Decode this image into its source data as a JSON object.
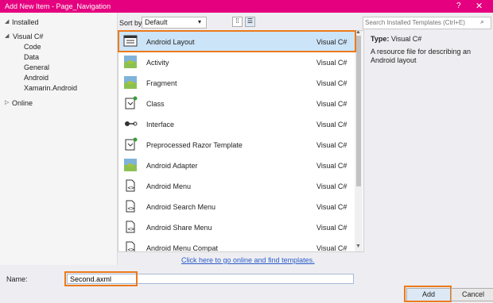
{
  "window": {
    "title": "Add New Item - Page_Navigation",
    "help_glyph": "?",
    "close_glyph": "✕"
  },
  "tree": {
    "installed": "Installed",
    "visual_csharp": "Visual C#",
    "children": [
      "Code",
      "Data",
      "General",
      "Android",
      "Xamarin.Android"
    ],
    "online": "Online"
  },
  "toolbar": {
    "sort_label": "Sort by:",
    "sort_value": "Default"
  },
  "templates": [
    {
      "name": "Android Layout",
      "lang": "Visual C#",
      "icon": "layout-icon"
    },
    {
      "name": "Activity",
      "lang": "Visual C#",
      "icon": "android-icon"
    },
    {
      "name": "Fragment",
      "lang": "Visual C#",
      "icon": "android-icon"
    },
    {
      "name": "Class",
      "lang": "Visual C#",
      "icon": "class-icon"
    },
    {
      "name": "Interface",
      "lang": "Visual C#",
      "icon": "interface-icon"
    },
    {
      "name": "Preprocessed Razor Template",
      "lang": "Visual C#",
      "icon": "razor-icon"
    },
    {
      "name": "Android Adapter",
      "lang": "Visual C#",
      "icon": "android-icon"
    },
    {
      "name": "Android Menu",
      "lang": "Visual C#",
      "icon": "menu-icon"
    },
    {
      "name": "Android Search Menu",
      "lang": "Visual C#",
      "icon": "menu-icon"
    },
    {
      "name": "Android Share Menu",
      "lang": "Visual C#",
      "icon": "menu-icon"
    },
    {
      "name": "Android Menu Compat",
      "lang": "Visual C#",
      "icon": "menu-icon"
    }
  ],
  "details": {
    "search_placeholder": "Search Installed Templates (Ctrl+E)",
    "type_label": "Type:",
    "type_value": "Visual C#",
    "description": "A resource file for describing an Android layout"
  },
  "footer": {
    "online_link": "Click here to go online and find templates.",
    "name_label": "Name:",
    "name_value": "Second.axml",
    "add_label": "Add",
    "cancel_label": "Cancel"
  },
  "colors": {
    "titlebar": "#e5007f",
    "highlight": "#ec7a1b",
    "selection": "#cce4f7",
    "link": "#2a5cc8"
  }
}
